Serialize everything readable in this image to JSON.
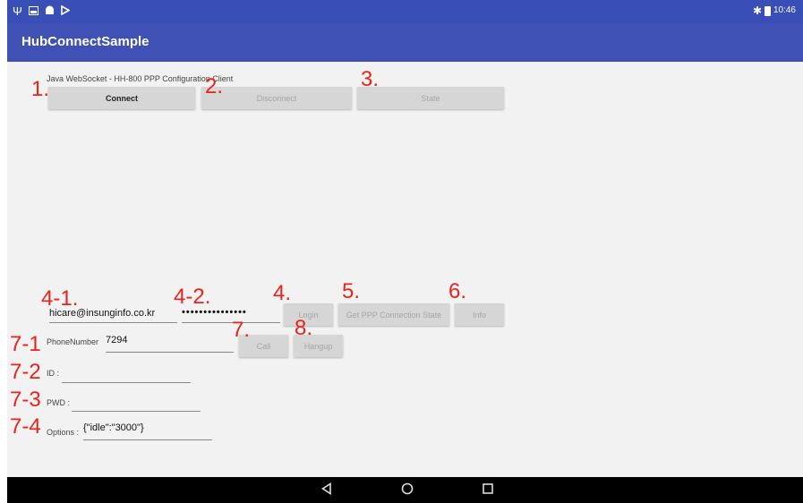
{
  "status_bar": {
    "time": "10:46"
  },
  "app_bar": {
    "title": "HubConnectSample"
  },
  "header": {
    "description": "Java WebSocket - HH-800 PPP Configuration Client"
  },
  "buttons": {
    "connect": "Connect",
    "disconnect": "Disconnect",
    "state": "State",
    "login": "Login",
    "get_ppp_state": "Get PPP Connection State",
    "info": "Info",
    "call": "Call",
    "hangup": "Hangup"
  },
  "login_form": {
    "email": "hicare@insunginfo.co.kr",
    "password_mask": "•••••••••••••••"
  },
  "call_form": {
    "phone_label": "PhoneNumber",
    "phone_value": "7294",
    "id_label": "ID :",
    "id_value": "",
    "pwd_label": "PWD :",
    "pwd_value": "",
    "options_label": "Options :",
    "options_value": "{\"idle\":\"3000\"}"
  },
  "annotations": {
    "a1": "1.",
    "a2": "2.",
    "a3": "3.",
    "a41": "4-1.",
    "a42": "4-2.",
    "a4": "4.",
    "a5": "5.",
    "a6": "6.",
    "a7": "7.",
    "a8": "8.",
    "a71": "7-1",
    "a72": "7-2",
    "a73": "7-3",
    "a74": "7-4"
  },
  "colors": {
    "status_bar": "#3a4eb8",
    "app_bar": "#3f51b5",
    "background": "#f2f2f2",
    "annotation": "#e8231c",
    "button": "#d6d6d6"
  },
  "icons": {
    "status_left": [
      "usb-icon",
      "image-icon",
      "android-debug-icon",
      "play-store-icon"
    ],
    "status_right": [
      "bluetooth-icon",
      "battery-icon"
    ],
    "nav": [
      "back-icon",
      "home-icon",
      "recents-icon"
    ]
  }
}
